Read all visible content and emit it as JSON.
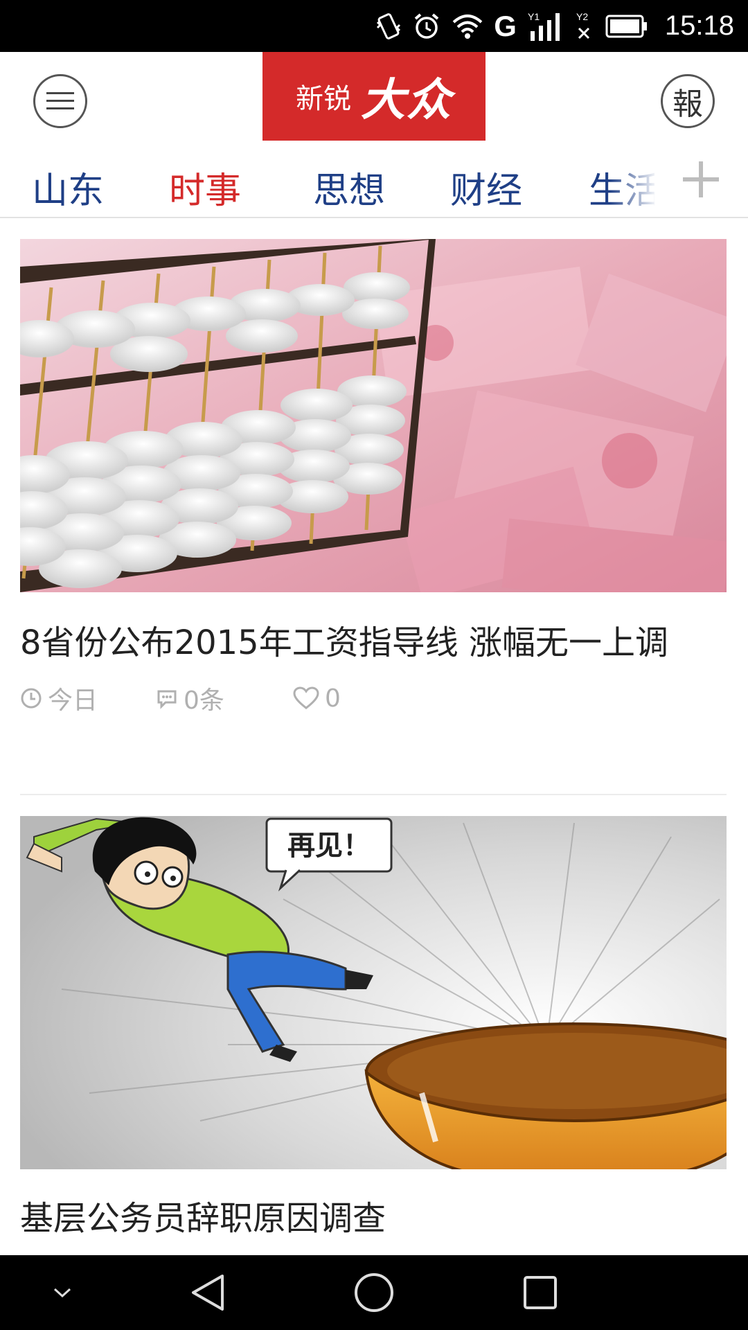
{
  "status_bar": {
    "time": "15:18",
    "network": "G",
    "sim1": "1",
    "sim2": "2",
    "icons": [
      "vibrate-icon",
      "alarm-icon",
      "wifi-icon",
      "signal-icon",
      "battery-icon"
    ]
  },
  "header": {
    "logo_small": "新锐",
    "logo_big": "大众",
    "paper_label": "報",
    "menu_icon": "hamburger-menu-icon"
  },
  "tabs": [
    {
      "label": "山东",
      "active": false
    },
    {
      "label": "时事",
      "active": true
    },
    {
      "label": "思想",
      "active": false
    },
    {
      "label": "财经",
      "active": false
    },
    {
      "label": "生活",
      "active": false
    }
  ],
  "add_tab_icon": "plus-icon",
  "articles": [
    {
      "image_desc": "abacus-on-banknotes",
      "title": "8省份公布2015年工资指导线 涨幅无一上调",
      "time": "今日",
      "comments": "0条",
      "likes": "0"
    },
    {
      "image_desc": "cartoon-civil-servant-leaving",
      "image_caption": "再见！",
      "title": "基层公务员辞职原因调查"
    }
  ],
  "colors": {
    "brand_red": "#d42a2a",
    "tab_blue": "#1f3f86",
    "meta_gray": "#b0b0b0"
  },
  "nav_bar": {
    "icons": [
      "collapse-icon",
      "back-icon",
      "home-icon",
      "recents-icon"
    ]
  }
}
